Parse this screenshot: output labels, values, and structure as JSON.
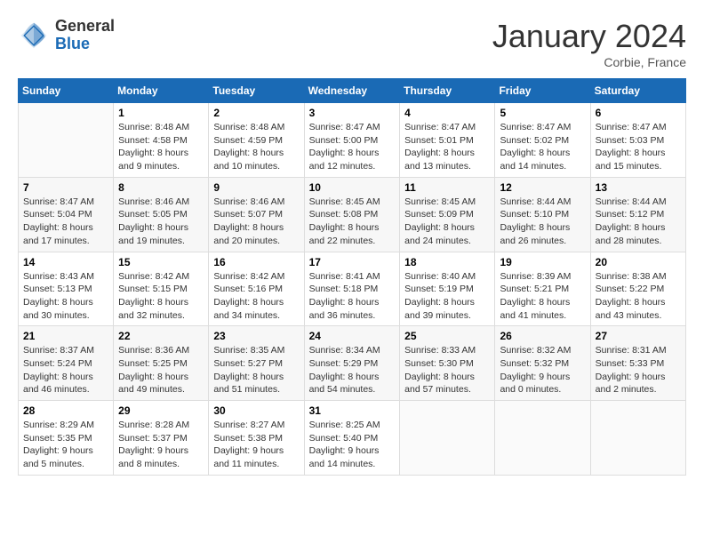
{
  "header": {
    "logo": {
      "general": "General",
      "blue": "Blue"
    },
    "title": "January 2024",
    "location": "Corbie, France"
  },
  "calendar": {
    "headers": [
      "Sunday",
      "Monday",
      "Tuesday",
      "Wednesday",
      "Thursday",
      "Friday",
      "Saturday"
    ],
    "weeks": [
      [
        {
          "day": "",
          "info": ""
        },
        {
          "day": "1",
          "info": "Sunrise: 8:48 AM\nSunset: 4:58 PM\nDaylight: 8 hours\nand 9 minutes."
        },
        {
          "day": "2",
          "info": "Sunrise: 8:48 AM\nSunset: 4:59 PM\nDaylight: 8 hours\nand 10 minutes."
        },
        {
          "day": "3",
          "info": "Sunrise: 8:47 AM\nSunset: 5:00 PM\nDaylight: 8 hours\nand 12 minutes."
        },
        {
          "day": "4",
          "info": "Sunrise: 8:47 AM\nSunset: 5:01 PM\nDaylight: 8 hours\nand 13 minutes."
        },
        {
          "day": "5",
          "info": "Sunrise: 8:47 AM\nSunset: 5:02 PM\nDaylight: 8 hours\nand 14 minutes."
        },
        {
          "day": "6",
          "info": "Sunrise: 8:47 AM\nSunset: 5:03 PM\nDaylight: 8 hours\nand 15 minutes."
        }
      ],
      [
        {
          "day": "7",
          "info": "Sunrise: 8:47 AM\nSunset: 5:04 PM\nDaylight: 8 hours\nand 17 minutes."
        },
        {
          "day": "8",
          "info": "Sunrise: 8:46 AM\nSunset: 5:05 PM\nDaylight: 8 hours\nand 19 minutes."
        },
        {
          "day": "9",
          "info": "Sunrise: 8:46 AM\nSunset: 5:07 PM\nDaylight: 8 hours\nand 20 minutes."
        },
        {
          "day": "10",
          "info": "Sunrise: 8:45 AM\nSunset: 5:08 PM\nDaylight: 8 hours\nand 22 minutes."
        },
        {
          "day": "11",
          "info": "Sunrise: 8:45 AM\nSunset: 5:09 PM\nDaylight: 8 hours\nand 24 minutes."
        },
        {
          "day": "12",
          "info": "Sunrise: 8:44 AM\nSunset: 5:10 PM\nDaylight: 8 hours\nand 26 minutes."
        },
        {
          "day": "13",
          "info": "Sunrise: 8:44 AM\nSunset: 5:12 PM\nDaylight: 8 hours\nand 28 minutes."
        }
      ],
      [
        {
          "day": "14",
          "info": "Sunrise: 8:43 AM\nSunset: 5:13 PM\nDaylight: 8 hours\nand 30 minutes."
        },
        {
          "day": "15",
          "info": "Sunrise: 8:42 AM\nSunset: 5:15 PM\nDaylight: 8 hours\nand 32 minutes."
        },
        {
          "day": "16",
          "info": "Sunrise: 8:42 AM\nSunset: 5:16 PM\nDaylight: 8 hours\nand 34 minutes."
        },
        {
          "day": "17",
          "info": "Sunrise: 8:41 AM\nSunset: 5:18 PM\nDaylight: 8 hours\nand 36 minutes."
        },
        {
          "day": "18",
          "info": "Sunrise: 8:40 AM\nSunset: 5:19 PM\nDaylight: 8 hours\nand 39 minutes."
        },
        {
          "day": "19",
          "info": "Sunrise: 8:39 AM\nSunset: 5:21 PM\nDaylight: 8 hours\nand 41 minutes."
        },
        {
          "day": "20",
          "info": "Sunrise: 8:38 AM\nSunset: 5:22 PM\nDaylight: 8 hours\nand 43 minutes."
        }
      ],
      [
        {
          "day": "21",
          "info": "Sunrise: 8:37 AM\nSunset: 5:24 PM\nDaylight: 8 hours\nand 46 minutes."
        },
        {
          "day": "22",
          "info": "Sunrise: 8:36 AM\nSunset: 5:25 PM\nDaylight: 8 hours\nand 49 minutes."
        },
        {
          "day": "23",
          "info": "Sunrise: 8:35 AM\nSunset: 5:27 PM\nDaylight: 8 hours\nand 51 minutes."
        },
        {
          "day": "24",
          "info": "Sunrise: 8:34 AM\nSunset: 5:29 PM\nDaylight: 8 hours\nand 54 minutes."
        },
        {
          "day": "25",
          "info": "Sunrise: 8:33 AM\nSunset: 5:30 PM\nDaylight: 8 hours\nand 57 minutes."
        },
        {
          "day": "26",
          "info": "Sunrise: 8:32 AM\nSunset: 5:32 PM\nDaylight: 9 hours\nand 0 minutes."
        },
        {
          "day": "27",
          "info": "Sunrise: 8:31 AM\nSunset: 5:33 PM\nDaylight: 9 hours\nand 2 minutes."
        }
      ],
      [
        {
          "day": "28",
          "info": "Sunrise: 8:29 AM\nSunset: 5:35 PM\nDaylight: 9 hours\nand 5 minutes."
        },
        {
          "day": "29",
          "info": "Sunrise: 8:28 AM\nSunset: 5:37 PM\nDaylight: 9 hours\nand 8 minutes."
        },
        {
          "day": "30",
          "info": "Sunrise: 8:27 AM\nSunset: 5:38 PM\nDaylight: 9 hours\nand 11 minutes."
        },
        {
          "day": "31",
          "info": "Sunrise: 8:25 AM\nSunset: 5:40 PM\nDaylight: 9 hours\nand 14 minutes."
        },
        {
          "day": "",
          "info": ""
        },
        {
          "day": "",
          "info": ""
        },
        {
          "day": "",
          "info": ""
        }
      ]
    ]
  }
}
